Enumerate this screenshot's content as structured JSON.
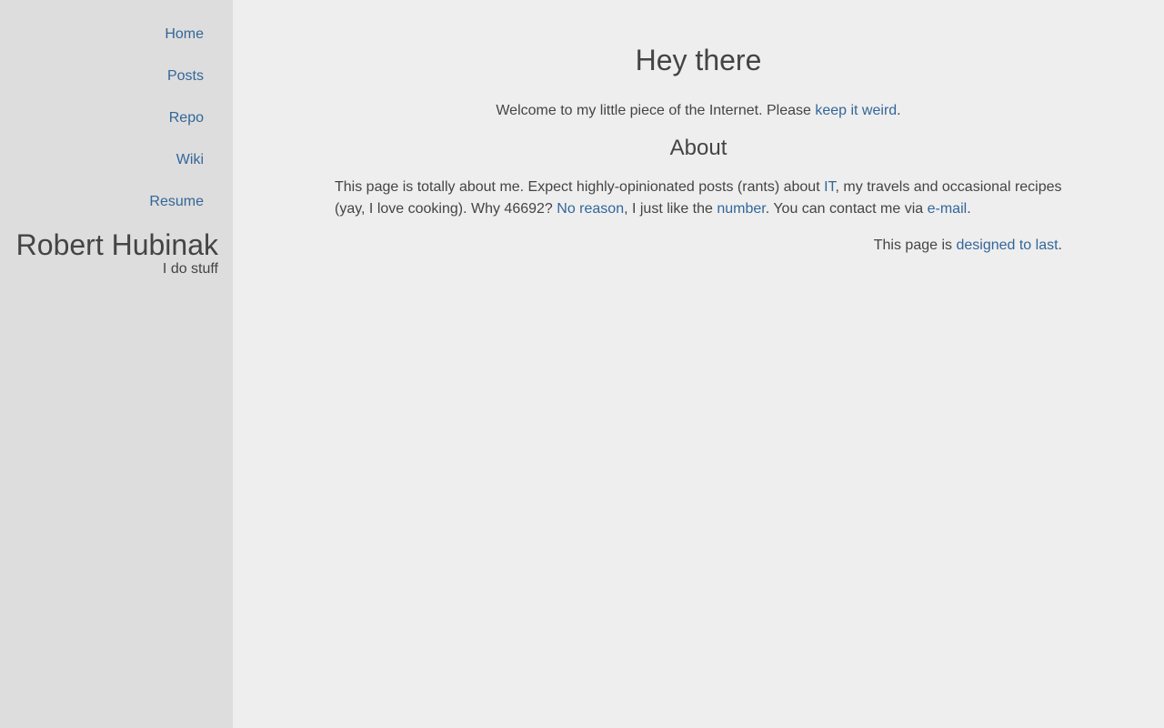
{
  "sidebar": {
    "nav": [
      {
        "label": "Home"
      },
      {
        "label": "Posts"
      },
      {
        "label": "Repo"
      },
      {
        "label": "Wiki"
      },
      {
        "label": "Resume"
      }
    ],
    "brand_name": "Robert Hubinak",
    "tagline": "I do stuff"
  },
  "main": {
    "title": "Hey there",
    "welcome": {
      "before": "Welcome to my little piece of the Internet. Please ",
      "link": "keep it weird",
      "after": "."
    },
    "about_title": "About",
    "about": {
      "t1": "This page is totally about me. Expect highly-opinionated posts (rants) about ",
      "link_it": "IT",
      "t2": ", my travels and occasional recipes (yay, I love cooking). Why 46692? ",
      "link_reason": "No reason",
      "t3": ", I just like the ",
      "link_number": "number",
      "t4": ". You can contact me via ",
      "link_email": "e-mail",
      "t5": "."
    },
    "footer": {
      "before": "This page is ",
      "link": "designed to last",
      "after": "."
    }
  },
  "colors": {
    "link": "#336699",
    "text": "#444444",
    "sidebar_bg": "#dddddd",
    "main_bg": "#eeeeee"
  }
}
